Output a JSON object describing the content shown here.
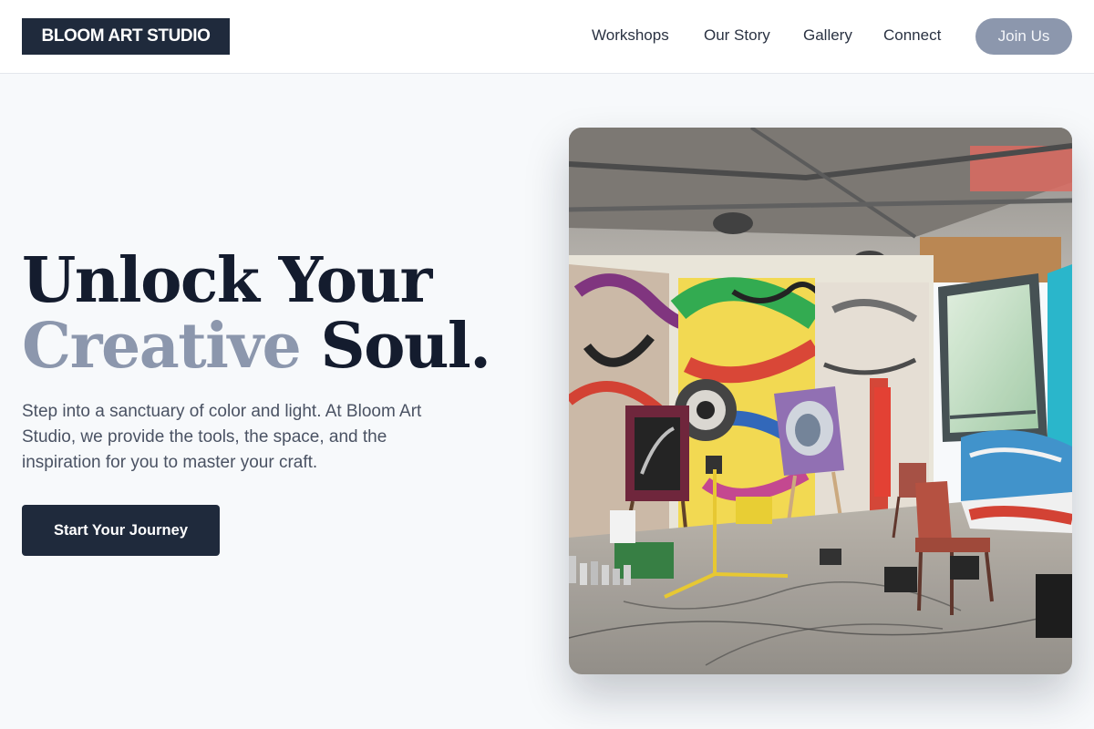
{
  "header": {
    "logo_text": "BLOOM ART STUDIO",
    "nav": {
      "workshops": "Workshops",
      "story": "Our Story",
      "gallery": "Gallery",
      "connect": "Connect"
    },
    "cta": "Join Us"
  },
  "hero": {
    "title_line1": "Unlock Your",
    "title_word_muted": "Creative",
    "title_word_end": "Soul.",
    "description": "Step into a sanctuary of color and light. At Bloom Art Studio, we provide the tools, the space, and the inspiration for you to master your craft.",
    "button_label": "Start Your Journey"
  },
  "colors": {
    "primary_dark": "#1f2a3c",
    "muted_accent": "#8c97ad",
    "background": "#f7f9fb"
  }
}
